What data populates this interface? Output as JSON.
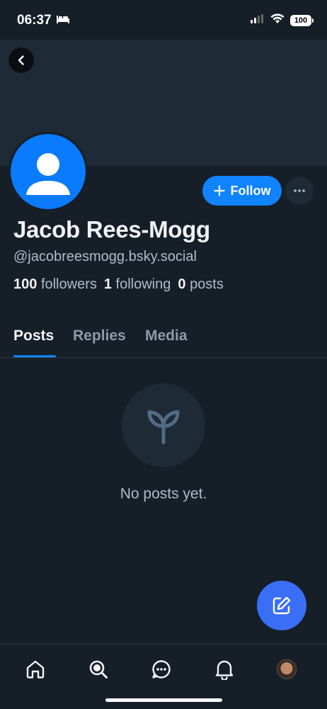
{
  "status_bar": {
    "time": "06:37",
    "battery": "100"
  },
  "profile": {
    "display_name": "Jacob Rees-Mogg",
    "handle": "@jacobreesmogg.bsky.social",
    "followers_count": "100",
    "followers_label": "followers",
    "following_count": "1",
    "following_label": "following",
    "posts_count": "0",
    "posts_label": "posts"
  },
  "actions": {
    "follow_label": "Follow"
  },
  "tabs": [
    {
      "label": "Posts",
      "active": true
    },
    {
      "label": "Replies",
      "active": false
    },
    {
      "label": "Media",
      "active": false
    }
  ],
  "empty_state": {
    "message": "No posts yet.",
    "icon": "seedling-icon"
  },
  "bottom_nav": [
    {
      "name": "home",
      "icon": "home-icon"
    },
    {
      "name": "search",
      "icon": "search-icon"
    },
    {
      "name": "chat",
      "icon": "chat-icon"
    },
    {
      "name": "notifications",
      "icon": "bell-icon"
    },
    {
      "name": "profile",
      "icon": "avatar"
    }
  ],
  "colors": {
    "background": "#161e27",
    "banner": "#1e2a36",
    "accent": "#1083fe",
    "avatar_bg": "#0a7aff",
    "compose": "#3a6ff5"
  }
}
